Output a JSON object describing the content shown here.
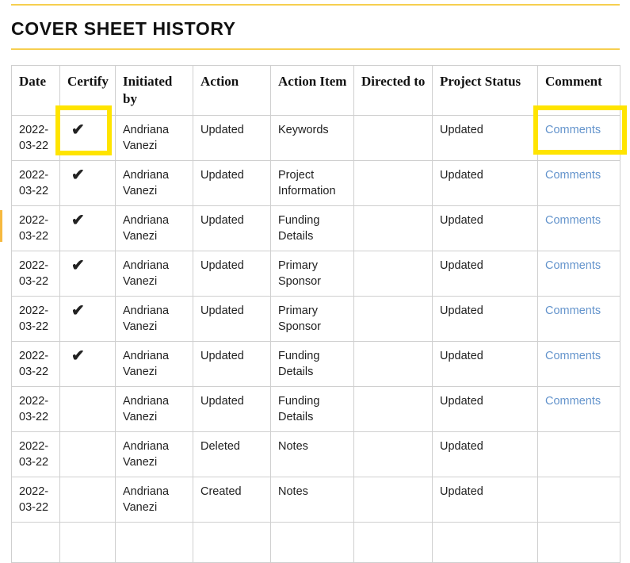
{
  "page": {
    "title": "COVER SHEET HISTORY",
    "accent_gold": "#f6cf50",
    "highlight_color": "#ffe400",
    "link_color": "#6494cc"
  },
  "table": {
    "headers": [
      "Date",
      "Certify",
      "Initiated by",
      "Action",
      "Action Item",
      "Directed to",
      "Project Status",
      "Comment"
    ],
    "check_glyph": "✔",
    "comment_link_label": "Comments",
    "rows": [
      {
        "date": "2022-03-22",
        "certify": true,
        "initiated_by": "Andriana Vanezi",
        "action": "Updated",
        "action_item": "Keywords",
        "directed_to": "",
        "project_status": "Updated",
        "comment": "Comments"
      },
      {
        "date": "2022-03-22",
        "certify": true,
        "initiated_by": "Andriana Vanezi",
        "action": "Updated",
        "action_item": "Project Information",
        "directed_to": "",
        "project_status": "Updated",
        "comment": "Comments"
      },
      {
        "date": "2022-03-22",
        "certify": true,
        "initiated_by": "Andriana Vanezi",
        "action": "Updated",
        "action_item": "Funding Details",
        "directed_to": "",
        "project_status": "Updated",
        "comment": "Comments"
      },
      {
        "date": "2022-03-22",
        "certify": true,
        "initiated_by": "Andriana Vanezi",
        "action": "Updated",
        "action_item": "Primary Sponsor",
        "directed_to": "",
        "project_status": "Updated",
        "comment": "Comments"
      },
      {
        "date": "2022-03-22",
        "certify": true,
        "initiated_by": "Andriana Vanezi",
        "action": "Updated",
        "action_item": "Primary Sponsor",
        "directed_to": "",
        "project_status": "Updated",
        "comment": "Comments"
      },
      {
        "date": "2022-03-22",
        "certify": true,
        "initiated_by": "Andriana Vanezi",
        "action": "Updated",
        "action_item": "Funding Details",
        "directed_to": "",
        "project_status": "Updated",
        "comment": "Comments"
      },
      {
        "date": "2022-03-22",
        "certify": false,
        "initiated_by": "Andriana Vanezi",
        "action": "Updated",
        "action_item": "Funding Details",
        "directed_to": "",
        "project_status": "Updated",
        "comment": "Comments"
      },
      {
        "date": "2022-03-22",
        "certify": false,
        "initiated_by": "Andriana Vanezi",
        "action": "Deleted",
        "action_item": "Notes",
        "directed_to": "",
        "project_status": "Updated",
        "comment": ""
      },
      {
        "date": "2022-03-22",
        "certify": false,
        "initiated_by": "Andriana Vanezi",
        "action": "Created",
        "action_item": "Notes",
        "directed_to": "",
        "project_status": "Updated",
        "comment": ""
      },
      {
        "date": "",
        "certify": false,
        "initiated_by": "",
        "action": "",
        "action_item": "",
        "directed_to": "",
        "project_status": "",
        "comment": ""
      }
    ]
  },
  "highlights": [
    {
      "name": "certify-cell-highlight",
      "target": "row 1 Certify cell"
    },
    {
      "name": "comments-cell-highlight",
      "target": "row 1 Comment cell"
    }
  ]
}
